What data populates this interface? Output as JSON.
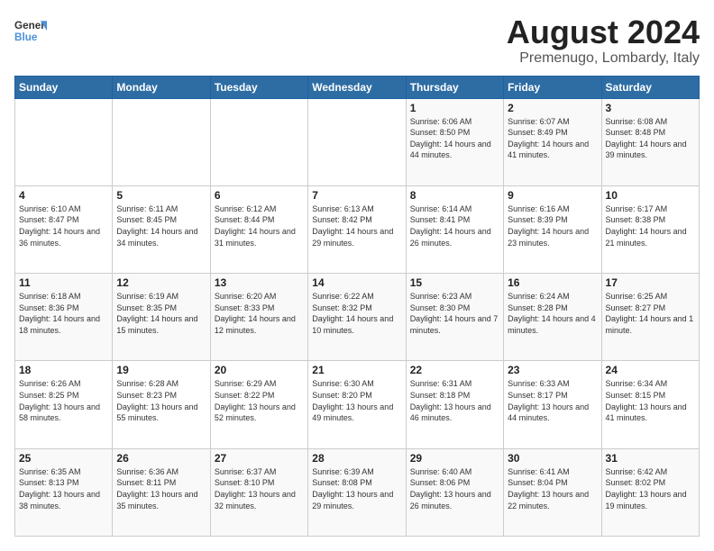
{
  "logo": {
    "general": "General",
    "blue": "Blue"
  },
  "title": "August 2024",
  "subtitle": "Premenugo, Lombardy, Italy",
  "days_of_week": [
    "Sunday",
    "Monday",
    "Tuesday",
    "Wednesday",
    "Thursday",
    "Friday",
    "Saturday"
  ],
  "weeks": [
    [
      {
        "day": "",
        "info": ""
      },
      {
        "day": "",
        "info": ""
      },
      {
        "day": "",
        "info": ""
      },
      {
        "day": "",
        "info": ""
      },
      {
        "day": "1",
        "info": "Sunrise: 6:06 AM\nSunset: 8:50 PM\nDaylight: 14 hours and 44 minutes."
      },
      {
        "day": "2",
        "info": "Sunrise: 6:07 AM\nSunset: 8:49 PM\nDaylight: 14 hours and 41 minutes."
      },
      {
        "day": "3",
        "info": "Sunrise: 6:08 AM\nSunset: 8:48 PM\nDaylight: 14 hours and 39 minutes."
      }
    ],
    [
      {
        "day": "4",
        "info": "Sunrise: 6:10 AM\nSunset: 8:47 PM\nDaylight: 14 hours and 36 minutes."
      },
      {
        "day": "5",
        "info": "Sunrise: 6:11 AM\nSunset: 8:45 PM\nDaylight: 14 hours and 34 minutes."
      },
      {
        "day": "6",
        "info": "Sunrise: 6:12 AM\nSunset: 8:44 PM\nDaylight: 14 hours and 31 minutes."
      },
      {
        "day": "7",
        "info": "Sunrise: 6:13 AM\nSunset: 8:42 PM\nDaylight: 14 hours and 29 minutes."
      },
      {
        "day": "8",
        "info": "Sunrise: 6:14 AM\nSunset: 8:41 PM\nDaylight: 14 hours and 26 minutes."
      },
      {
        "day": "9",
        "info": "Sunrise: 6:16 AM\nSunset: 8:39 PM\nDaylight: 14 hours and 23 minutes."
      },
      {
        "day": "10",
        "info": "Sunrise: 6:17 AM\nSunset: 8:38 PM\nDaylight: 14 hours and 21 minutes."
      }
    ],
    [
      {
        "day": "11",
        "info": "Sunrise: 6:18 AM\nSunset: 8:36 PM\nDaylight: 14 hours and 18 minutes."
      },
      {
        "day": "12",
        "info": "Sunrise: 6:19 AM\nSunset: 8:35 PM\nDaylight: 14 hours and 15 minutes."
      },
      {
        "day": "13",
        "info": "Sunrise: 6:20 AM\nSunset: 8:33 PM\nDaylight: 14 hours and 12 minutes."
      },
      {
        "day": "14",
        "info": "Sunrise: 6:22 AM\nSunset: 8:32 PM\nDaylight: 14 hours and 10 minutes."
      },
      {
        "day": "15",
        "info": "Sunrise: 6:23 AM\nSunset: 8:30 PM\nDaylight: 14 hours and 7 minutes."
      },
      {
        "day": "16",
        "info": "Sunrise: 6:24 AM\nSunset: 8:28 PM\nDaylight: 14 hours and 4 minutes."
      },
      {
        "day": "17",
        "info": "Sunrise: 6:25 AM\nSunset: 8:27 PM\nDaylight: 14 hours and 1 minute."
      }
    ],
    [
      {
        "day": "18",
        "info": "Sunrise: 6:26 AM\nSunset: 8:25 PM\nDaylight: 13 hours and 58 minutes."
      },
      {
        "day": "19",
        "info": "Sunrise: 6:28 AM\nSunset: 8:23 PM\nDaylight: 13 hours and 55 minutes."
      },
      {
        "day": "20",
        "info": "Sunrise: 6:29 AM\nSunset: 8:22 PM\nDaylight: 13 hours and 52 minutes."
      },
      {
        "day": "21",
        "info": "Sunrise: 6:30 AM\nSunset: 8:20 PM\nDaylight: 13 hours and 49 minutes."
      },
      {
        "day": "22",
        "info": "Sunrise: 6:31 AM\nSunset: 8:18 PM\nDaylight: 13 hours and 46 minutes."
      },
      {
        "day": "23",
        "info": "Sunrise: 6:33 AM\nSunset: 8:17 PM\nDaylight: 13 hours and 44 minutes."
      },
      {
        "day": "24",
        "info": "Sunrise: 6:34 AM\nSunset: 8:15 PM\nDaylight: 13 hours and 41 minutes."
      }
    ],
    [
      {
        "day": "25",
        "info": "Sunrise: 6:35 AM\nSunset: 8:13 PM\nDaylight: 13 hours and 38 minutes."
      },
      {
        "day": "26",
        "info": "Sunrise: 6:36 AM\nSunset: 8:11 PM\nDaylight: 13 hours and 35 minutes."
      },
      {
        "day": "27",
        "info": "Sunrise: 6:37 AM\nSunset: 8:10 PM\nDaylight: 13 hours and 32 minutes."
      },
      {
        "day": "28",
        "info": "Sunrise: 6:39 AM\nSunset: 8:08 PM\nDaylight: 13 hours and 29 minutes."
      },
      {
        "day": "29",
        "info": "Sunrise: 6:40 AM\nSunset: 8:06 PM\nDaylight: 13 hours and 26 minutes."
      },
      {
        "day": "30",
        "info": "Sunrise: 6:41 AM\nSunset: 8:04 PM\nDaylight: 13 hours and 22 minutes."
      },
      {
        "day": "31",
        "info": "Sunrise: 6:42 AM\nSunset: 8:02 PM\nDaylight: 13 hours and 19 minutes."
      }
    ]
  ]
}
